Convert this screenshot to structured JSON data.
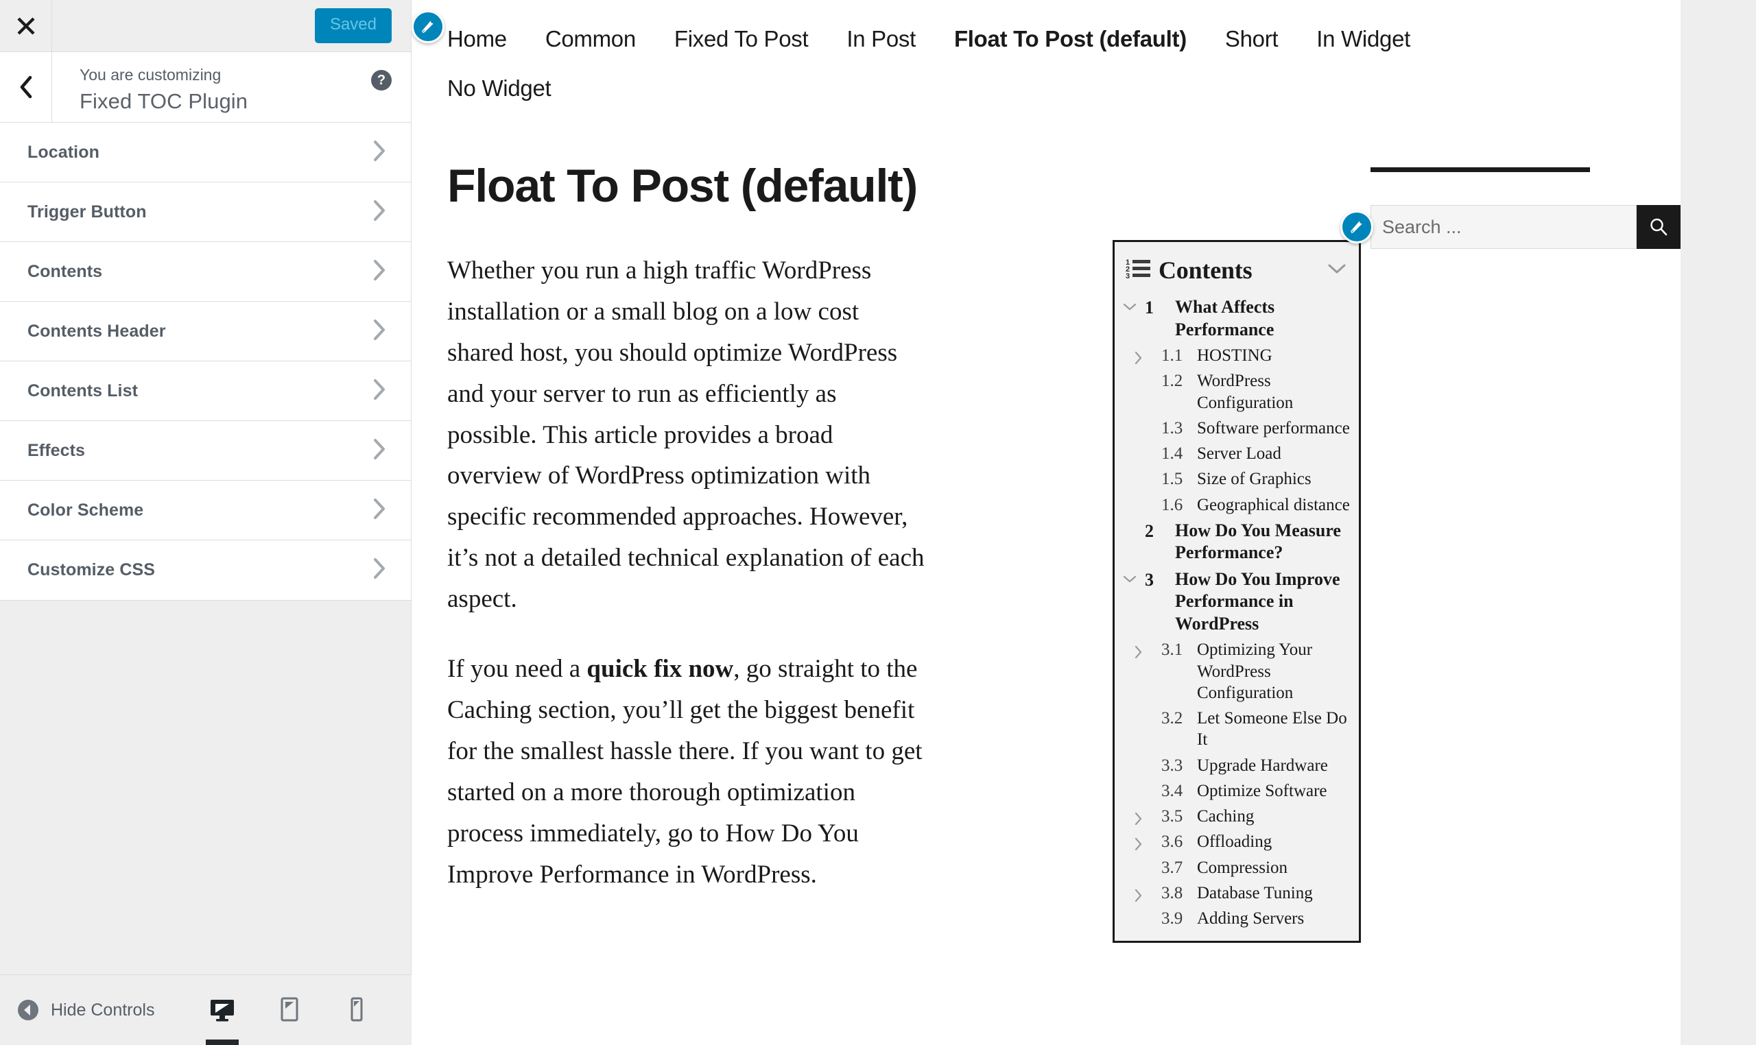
{
  "customizer": {
    "close_label": "Close",
    "save_button_label": "Saved",
    "back_label": "Back",
    "subtitle": "You are customizing",
    "title": "Fixed TOC Plugin",
    "help_label": "?",
    "sections": [
      {
        "label": "Location"
      },
      {
        "label": "Trigger Button"
      },
      {
        "label": "Contents"
      },
      {
        "label": "Contents Header"
      },
      {
        "label": "Contents List"
      },
      {
        "label": "Effects"
      },
      {
        "label": "Color Scheme"
      },
      {
        "label": "Customize CSS"
      }
    ],
    "footer": {
      "hide_controls_label": "Hide Controls",
      "devices": [
        {
          "name": "desktop",
          "active": true
        },
        {
          "name": "tablet",
          "active": false
        },
        {
          "name": "mobile",
          "active": false
        }
      ]
    },
    "accent_color": "#0085ba"
  },
  "preview": {
    "nav": [
      {
        "label": "Home",
        "current": false
      },
      {
        "label": "Common",
        "current": false
      },
      {
        "label": "Fixed To Post",
        "current": false
      },
      {
        "label": "In Post",
        "current": false
      },
      {
        "label": "Float To Post (default)",
        "current": true
      },
      {
        "label": "Short",
        "current": false
      },
      {
        "label": "In Widget",
        "current": false
      },
      {
        "label": "No Widget",
        "current": false
      }
    ],
    "post": {
      "title": "Float To Post (default)",
      "paragraph1": "Whether you run a high traffic WordPress installation or a small blog on a low cost shared host, you should optimize WordPress and your server to run as efficiently as possible. This article provides a broad overview of WordPress optimization with specific recommended approaches. However, it’s not a detailed technical explanation of each aspect.",
      "paragraph2_before": "If you need a ",
      "paragraph2_bold": "quick fix now",
      "paragraph2_after": ", go straight to the Caching section, you’ll get the biggest benefit for the smallest hassle there. If you want to get started on a more thorough optimization process immediately, go to How Do You Improve Performance in WordPress."
    },
    "toc": {
      "title": "Contents",
      "items": [
        {
          "level": 1,
          "number": "1",
          "text": "What Affects Performance",
          "twist": "down"
        },
        {
          "level": 2,
          "number": "1.1",
          "text": "HOSTING",
          "twist": "right"
        },
        {
          "level": 2,
          "number": "1.2",
          "text": "WordPress Configuration",
          "twist": "none"
        },
        {
          "level": 2,
          "number": "1.3",
          "text": "Software performance",
          "twist": "none"
        },
        {
          "level": 2,
          "number": "1.4",
          "text": "Server Load",
          "twist": "none"
        },
        {
          "level": 2,
          "number": "1.5",
          "text": "Size of Graphics",
          "twist": "none"
        },
        {
          "level": 2,
          "number": "1.6",
          "text": "Geographical distance",
          "twist": "none"
        },
        {
          "level": 1,
          "number": "2",
          "text": "How Do You Measure Performance?",
          "twist": "none"
        },
        {
          "level": 1,
          "number": "3",
          "text": "How Do You Improve Performance in WordPress",
          "twist": "down"
        },
        {
          "level": 2,
          "number": "3.1",
          "text": "Optimizing Your WordPress Configuration",
          "twist": "right"
        },
        {
          "level": 2,
          "number": "3.2",
          "text": "Let Someone Else Do It",
          "twist": "none"
        },
        {
          "level": 2,
          "number": "3.3",
          "text": "Upgrade Hardware",
          "twist": "none"
        },
        {
          "level": 2,
          "number": "3.4",
          "text": "Optimize Software",
          "twist": "none"
        },
        {
          "level": 2,
          "number": "3.5",
          "text": "Caching",
          "twist": "right"
        },
        {
          "level": 2,
          "number": "3.6",
          "text": "Offloading",
          "twist": "right"
        },
        {
          "level": 2,
          "number": "3.7",
          "text": "Compression",
          "twist": "none"
        },
        {
          "level": 2,
          "number": "3.8",
          "text": "Database Tuning",
          "twist": "right"
        },
        {
          "level": 2,
          "number": "3.9",
          "text": "Adding Servers",
          "twist": "none"
        }
      ]
    },
    "search": {
      "placeholder": "Search ...",
      "value": "",
      "submit_label": "Search"
    }
  }
}
